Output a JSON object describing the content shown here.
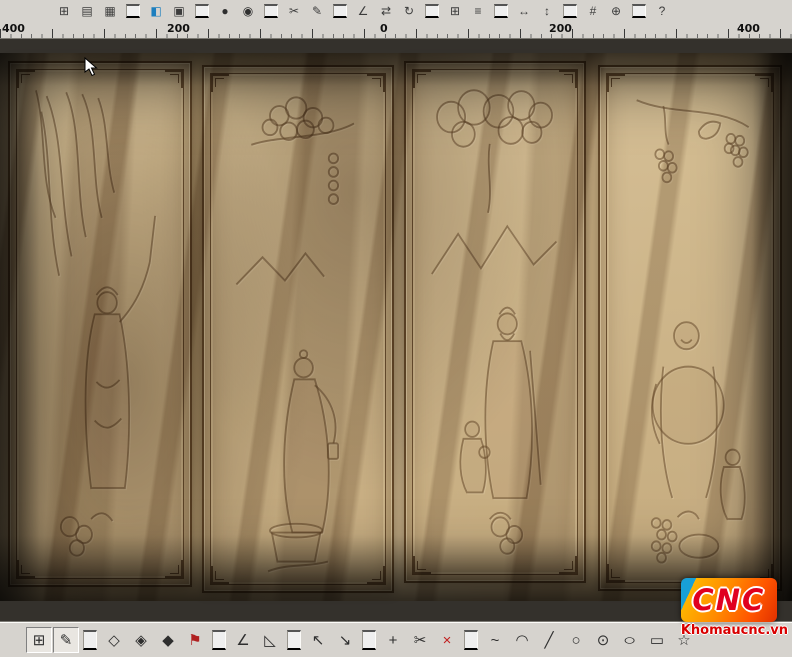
{
  "app": {
    "toolbar_bg": "#d6d3ce",
    "canvas_bg": "#34312c"
  },
  "ruler": {
    "labels": [
      "400",
      "200",
      "0",
      "200",
      "400"
    ]
  },
  "top_toolbar": {
    "icons": [
      {
        "name": "view-grid",
        "glyph": "⊞"
      },
      {
        "name": "view-sheet",
        "glyph": "▤"
      },
      {
        "name": "save",
        "glyph": "▦"
      },
      {
        "sep": true
      },
      {
        "name": "color-palette",
        "glyph": "◧",
        "color": "#1d7fbf"
      },
      {
        "name": "page-setup",
        "glyph": "▣"
      },
      {
        "sep": true
      },
      {
        "name": "sphere-view",
        "glyph": "●",
        "color": "#2f2f2f"
      },
      {
        "name": "render-target",
        "glyph": "◉",
        "color": "#2f2f2f"
      },
      {
        "sep": true
      },
      {
        "name": "cut",
        "glyph": "✂"
      },
      {
        "name": "draw-pen",
        "glyph": "✎"
      },
      {
        "sep": true
      },
      {
        "name": "measure-angle",
        "glyph": "∠"
      },
      {
        "name": "mirror",
        "glyph": "⇄"
      },
      {
        "name": "rotate",
        "glyph": "↻"
      },
      {
        "sep": true
      },
      {
        "name": "array-copy",
        "glyph": "⊞"
      },
      {
        "name": "align",
        "glyph": "≡"
      },
      {
        "sep": true
      },
      {
        "name": "dimension-horizontal",
        "glyph": "↔"
      },
      {
        "name": "dimension-vertical",
        "glyph": "↕"
      },
      {
        "sep": true
      },
      {
        "name": "node-grid",
        "glyph": "#"
      },
      {
        "name": "merge",
        "glyph": "⊕"
      },
      {
        "sep": true
      },
      {
        "name": "help",
        "glyph": "?"
      }
    ]
  },
  "bottom_toolbar": {
    "icons": [
      {
        "name": "select-mode",
        "glyph": "⊞",
        "pressed": true
      },
      {
        "name": "node-edit-pen",
        "glyph": "✎",
        "pressed": true
      },
      {
        "sep": true
      },
      {
        "name": "vertex-tool",
        "glyph": "◇"
      },
      {
        "name": "vertex-smooth",
        "glyph": "◈"
      },
      {
        "name": "vertex-corner",
        "glyph": "◆"
      },
      {
        "name": "flag-marker",
        "glyph": "⚑",
        "color": "#b02020"
      },
      {
        "sep": true
      },
      {
        "name": "slope-tool",
        "glyph": "∠"
      },
      {
        "name": "ramp-tool",
        "glyph": "◺"
      },
      {
        "sep": true
      },
      {
        "name": "pick-arrow",
        "glyph": "↖"
      },
      {
        "name": "pick-node-arrow",
        "glyph": "↘"
      },
      {
        "sep": true
      },
      {
        "name": "insert-node",
        "glyph": "+"
      },
      {
        "name": "cut-curve",
        "glyph": "✂"
      },
      {
        "name": "delete-node",
        "glyph": "×",
        "color": "#c22020"
      },
      {
        "sep": true
      },
      {
        "name": "smooth-curve",
        "glyph": "~"
      },
      {
        "name": "arc-tool",
        "glyph": "◠"
      },
      {
        "name": "line-tool",
        "glyph": "╱"
      },
      {
        "name": "circle-tool",
        "glyph": "○"
      },
      {
        "name": "center-circle-tool",
        "glyph": "⊙"
      },
      {
        "name": "ellipse-tool",
        "glyph": "○",
        "cls": "wide"
      },
      {
        "name": "rectangle-tool",
        "glyph": "▭"
      },
      {
        "name": "star-tool",
        "glyph": "☆"
      }
    ]
  },
  "artwork": {
    "wood_base": "#c7ae83",
    "panels": [
      {
        "name": "carved-panel-1"
      },
      {
        "name": "carved-panel-2"
      },
      {
        "name": "carved-panel-3"
      },
      {
        "name": "carved-panel-4"
      }
    ]
  },
  "watermark": {
    "logo": "CNC",
    "site": "Khomaucnc.vn"
  }
}
